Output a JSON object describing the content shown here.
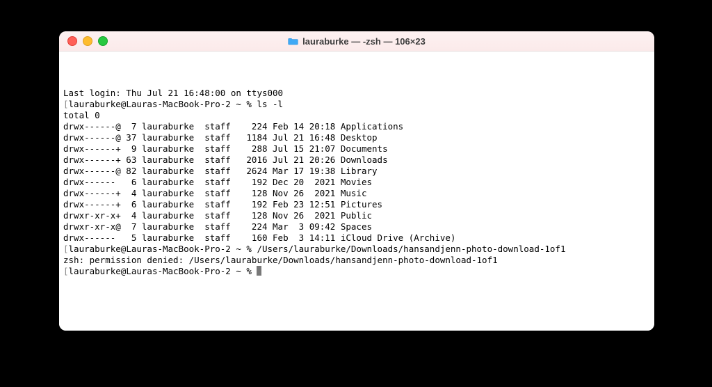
{
  "window": {
    "title": "lauraburke — -zsh — 106×23"
  },
  "terminal": {
    "last_login": "Last login: Thu Jul 21 16:48:00 on ttys000",
    "prompt_user_host": "lauraburke@Lauras-MacBook-Pro-2",
    "prompt_path": "~",
    "prompt_symbol": "%",
    "cmd1": "ls -l",
    "total_line": "total 0",
    "ls_rows": [
      {
        "perm": "drwx------@",
        "links": " 7",
        "owner": "lauraburke",
        "group": "staff",
        "size": "  224",
        "date": "Feb 14 20:18",
        "name": "Applications"
      },
      {
        "perm": "drwx------@",
        "links": "37",
        "owner": "lauraburke",
        "group": "staff",
        "size": " 1184",
        "date": "Jul 21 16:48",
        "name": "Desktop"
      },
      {
        "perm": "drwx------+",
        "links": " 9",
        "owner": "lauraburke",
        "group": "staff",
        "size": "  288",
        "date": "Jul 15 21:07",
        "name": "Documents"
      },
      {
        "perm": "drwx------+",
        "links": "63",
        "owner": "lauraburke",
        "group": "staff",
        "size": " 2016",
        "date": "Jul 21 20:26",
        "name": "Downloads"
      },
      {
        "perm": "drwx------@",
        "links": "82",
        "owner": "lauraburke",
        "group": "staff",
        "size": " 2624",
        "date": "Mar 17 19:38",
        "name": "Library"
      },
      {
        "perm": "drwx------ ",
        "links": " 6",
        "owner": "lauraburke",
        "group": "staff",
        "size": "  192",
        "date": "Dec 20  2021",
        "name": "Movies"
      },
      {
        "perm": "drwx------+",
        "links": " 4",
        "owner": "lauraburke",
        "group": "staff",
        "size": "  128",
        "date": "Nov 26  2021",
        "name": "Music"
      },
      {
        "perm": "drwx------+",
        "links": " 6",
        "owner": "lauraburke",
        "group": "staff",
        "size": "  192",
        "date": "Feb 23 12:51",
        "name": "Pictures"
      },
      {
        "perm": "drwxr-xr-x+",
        "links": " 4",
        "owner": "lauraburke",
        "group": "staff",
        "size": "  128",
        "date": "Nov 26  2021",
        "name": "Public"
      },
      {
        "perm": "drwxr-xr-x@",
        "links": " 7",
        "owner": "lauraburke",
        "group": "staff",
        "size": "  224",
        "date": "Mar  3 09:42",
        "name": "Spaces"
      },
      {
        "perm": "drwx------ ",
        "links": " 5",
        "owner": "lauraburke",
        "group": "staff",
        "size": "  160",
        "date": "Feb  3 14:11",
        "name": "iCloud Drive (Archive)"
      }
    ],
    "cmd2": "/Users/lauraburke/Downloads/hansandjenn-photo-download-1of1",
    "error_line": "zsh: permission denied: /Users/lauraburke/Downloads/hansandjenn-photo-download-1of1"
  }
}
